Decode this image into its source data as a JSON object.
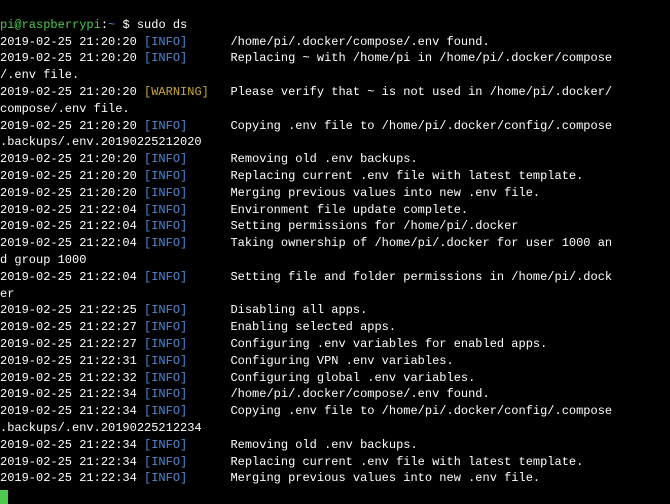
{
  "prompt": {
    "user": "pi",
    "at": "@",
    "host": "raspberrypi",
    "path": "~",
    "dollar": "$",
    "command": "sudo ds"
  },
  "log": [
    {
      "ts": "2019-02-25 21:20:20",
      "level": "[INFO]",
      "msg": "/home/pi/.docker/compose/.env found."
    },
    {
      "ts": "2019-02-25 21:20:20",
      "level": "[INFO]",
      "msg": "Replacing ~ with /home/pi in /home/pi/.docker/compose"
    },
    {
      "cont": "/.env file."
    },
    {
      "ts": "2019-02-25 21:20:20",
      "level": "[WARNING]",
      "msg": "Please verify that ~ is not used in /home/pi/.docker/"
    },
    {
      "cont": "compose/.env file."
    },
    {
      "ts": "2019-02-25 21:20:20",
      "level": "[INFO]",
      "msg": "Copying .env file to /home/pi/.docker/config/.compose"
    },
    {
      "cont": ".backups/.env.20190225212020"
    },
    {
      "ts": "2019-02-25 21:20:20",
      "level": "[INFO]",
      "msg": "Removing old .env backups."
    },
    {
      "ts": "2019-02-25 21:20:20",
      "level": "[INFO]",
      "msg": "Replacing current .env file with latest template."
    },
    {
      "ts": "2019-02-25 21:20:20",
      "level": "[INFO]",
      "msg": "Merging previous values into new .env file."
    },
    {
      "ts": "2019-02-25 21:22:04",
      "level": "[INFO]",
      "msg": "Environment file update complete."
    },
    {
      "ts": "2019-02-25 21:22:04",
      "level": "[INFO]",
      "msg": "Setting permissions for /home/pi/.docker"
    },
    {
      "ts": "2019-02-25 21:22:04",
      "level": "[INFO]",
      "msg": "Taking ownership of /home/pi/.docker for user 1000 an"
    },
    {
      "cont": "d group 1000"
    },
    {
      "ts": "2019-02-25 21:22:04",
      "level": "[INFO]",
      "msg": "Setting file and folder permissions in /home/pi/.dock"
    },
    {
      "cont": "er"
    },
    {
      "ts": "2019-02-25 21:22:25",
      "level": "[INFO]",
      "msg": "Disabling all apps."
    },
    {
      "ts": "2019-02-25 21:22:27",
      "level": "[INFO]",
      "msg": "Enabling selected apps."
    },
    {
      "ts": "2019-02-25 21:22:27",
      "level": "[INFO]",
      "msg": "Configuring .env variables for enabled apps."
    },
    {
      "ts": "2019-02-25 21:22:31",
      "level": "[INFO]",
      "msg": "Configuring VPN .env variables."
    },
    {
      "ts": "2019-02-25 21:22:32",
      "level": "[INFO]",
      "msg": "Configuring global .env variables."
    },
    {
      "ts": "2019-02-25 21:22:34",
      "level": "[INFO]",
      "msg": "/home/pi/.docker/compose/.env found."
    },
    {
      "ts": "2019-02-25 21:22:34",
      "level": "[INFO]",
      "msg": "Copying .env file to /home/pi/.docker/config/.compose"
    },
    {
      "cont": ".backups/.env.20190225212234"
    },
    {
      "ts": "2019-02-25 21:22:34",
      "level": "[INFO]",
      "msg": "Removing old .env backups."
    },
    {
      "ts": "2019-02-25 21:22:34",
      "level": "[INFO]",
      "msg": "Replacing current .env file with latest template."
    },
    {
      "ts": "2019-02-25 21:22:34",
      "level": "[INFO]",
      "msg": "Merging previous values into new .env file."
    }
  ]
}
